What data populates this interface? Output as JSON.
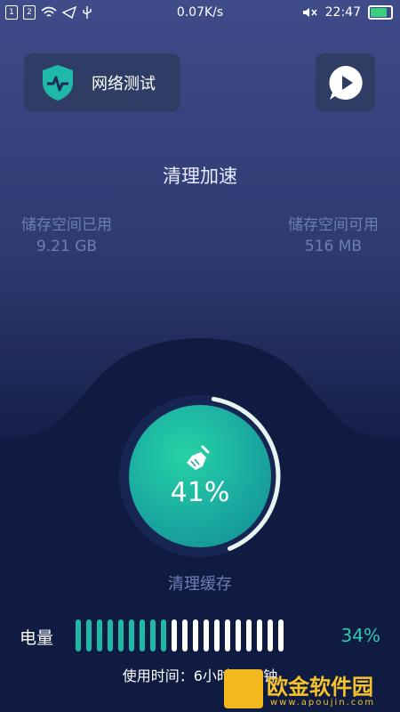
{
  "status_bar": {
    "sim1": "1",
    "sim2": "2",
    "speed": "0.07K/s",
    "time": "22:47"
  },
  "header": {
    "network_test_label": "网络测试"
  },
  "main": {
    "title": "清理加速",
    "storage_used_label": "储存空间已用",
    "storage_used_value": "9.21 GB",
    "storage_free_label": "储存空间可用",
    "storage_free_value": "516 MB",
    "clean_percent": "41%",
    "clean_fraction": 0.41,
    "clean_cache_label": "清理缓存"
  },
  "battery": {
    "label": "电量",
    "percent": "34%",
    "segments_total": 20,
    "segments_on": 9,
    "usage_text": "使用时间：6小时30分钟"
  },
  "watermark": {
    "brand": "欧金软件园",
    "domain": "www.apoujin.com"
  },
  "colors": {
    "accent": "#1fb9a9",
    "bg_top": "#3f4c89",
    "bg_bottom": "#0f1b40"
  }
}
